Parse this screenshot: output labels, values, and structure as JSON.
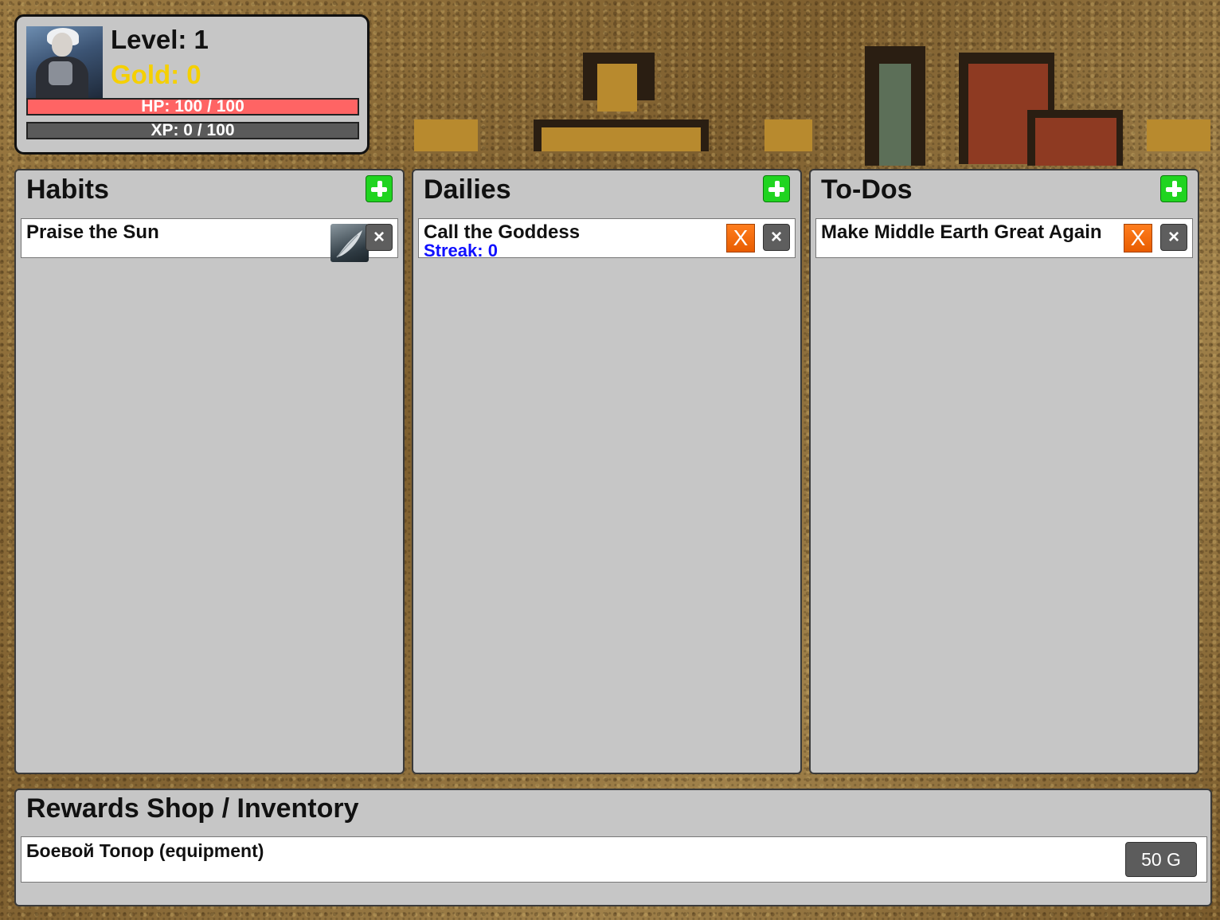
{
  "stats": {
    "level_text": "Level: 1",
    "gold_text": "Gold: 0",
    "hp_text": "HP: 100 / 100",
    "hp_fraction": 1.0,
    "xp_text": "XP: 0 / 100",
    "xp_fraction": 0.0
  },
  "columns": {
    "habits": {
      "title": "Habits",
      "tasks": [
        {
          "title": "Praise the Sun",
          "delete_label": "×"
        }
      ]
    },
    "dailies": {
      "title": "Dailies",
      "tasks": [
        {
          "title": "Call the Goddess",
          "streak": "Streak: 0",
          "complete_label": "X",
          "delete_label": "×"
        }
      ]
    },
    "todos": {
      "title": "To-Dos",
      "tasks": [
        {
          "title": "Make Middle Earth Great Again",
          "complete_label": "X",
          "delete_label": "×"
        }
      ]
    }
  },
  "rewards": {
    "title": "Rewards Shop / Inventory",
    "items": [
      {
        "name": "Боевой Топор (equipment)",
        "price": "50 G"
      }
    ]
  },
  "colors": {
    "gold": "#f5d000",
    "hp": "#ff6464",
    "add_button": "#20d420",
    "complete_button": "#ff7d1e",
    "streak": "#1010ff"
  },
  "icons": {
    "add": "plus-icon",
    "delete": "close-icon",
    "complete": "x-mark-icon",
    "habit_action": "feather-icon"
  }
}
